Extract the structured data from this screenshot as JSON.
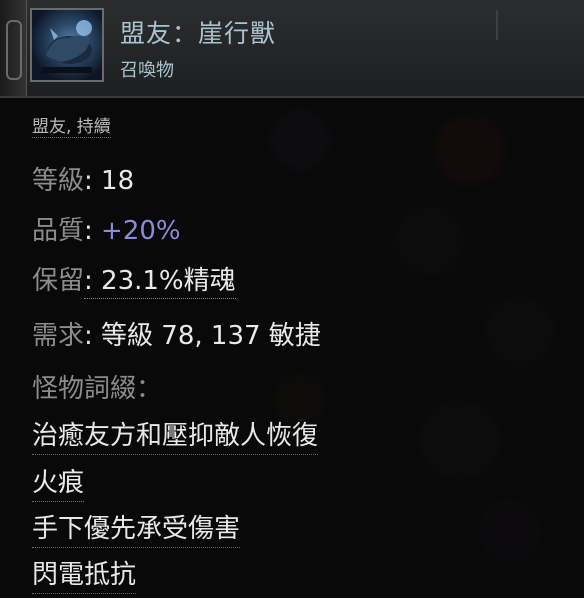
{
  "item": {
    "title": "盟友：崖行獸",
    "subtitle": "召喚物",
    "icon": "cliff-beast-companion-icon",
    "tags": "盟友, 持續"
  },
  "stats": {
    "level_label": "等級",
    "level_value": ": 18",
    "quality_label": "品質",
    "quality_sep": ": ",
    "quality_value": "+20%",
    "reservation_label": "保留",
    "reservation_value": ": 23.1%精魂",
    "requirement_label": "需求",
    "requirement_value": ": 等級 78, 137 敏捷"
  },
  "modifiers": {
    "header": "怪物詞綴：",
    "items": [
      "治癒友方和壓抑敵人恢復",
      "火痕",
      "手下優先承受傷害",
      "閃電抵抗"
    ]
  },
  "colors": {
    "header_text": "#a9c4cf",
    "augmented": "#8b8bdc",
    "label": "#8c8c8c",
    "value": "#e9e9e9"
  }
}
